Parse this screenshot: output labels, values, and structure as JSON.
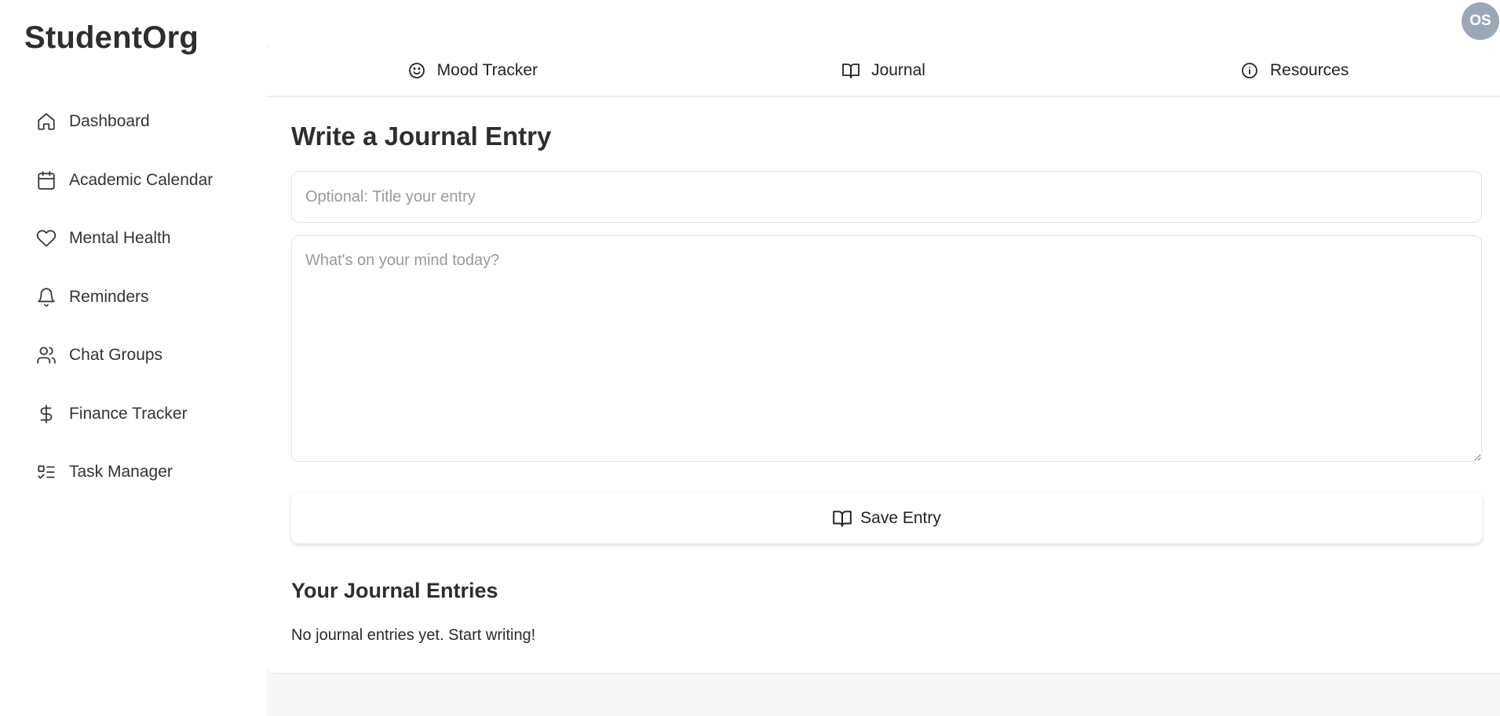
{
  "app": {
    "brand": "StudentOrg"
  },
  "sidebar": {
    "items": [
      {
        "label": "Dashboard",
        "icon": "home-icon"
      },
      {
        "label": "Academic Calendar",
        "icon": "calendar-icon"
      },
      {
        "label": "Mental Health",
        "icon": "heart-icon"
      },
      {
        "label": "Reminders",
        "icon": "bell-icon"
      },
      {
        "label": "Chat Groups",
        "icon": "users-icon"
      },
      {
        "label": "Finance Tracker",
        "icon": "dollar-icon"
      },
      {
        "label": "Task Manager",
        "icon": "list-checks-icon"
      }
    ]
  },
  "header": {
    "avatar_initials": "OS"
  },
  "tabs": [
    {
      "label": "Mood Tracker",
      "icon": "smile-icon"
    },
    {
      "label": "Journal",
      "icon": "book-open-icon"
    },
    {
      "label": "Resources",
      "icon": "info-icon"
    }
  ],
  "journal": {
    "heading": "Write a Journal Entry",
    "title_placeholder": "Optional: Title your entry",
    "body_placeholder": "What's on your mind today?",
    "save_label": "Save Entry",
    "save_icon": "book-open-icon",
    "entries_heading": "Your Journal Entries",
    "empty_message": "No journal entries yet. Start writing!"
  },
  "colors": {
    "avatar_bg": "#9aa8b8",
    "main_bg": "#f7f7f7",
    "text": "#2e2e2e",
    "placeholder": "#9a9a9a",
    "border": "#e3e3e3"
  }
}
